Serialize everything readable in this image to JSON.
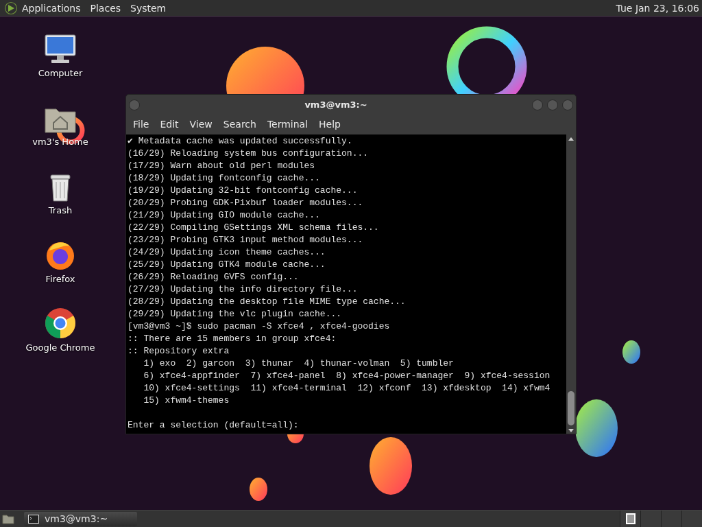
{
  "top_panel": {
    "menus": [
      "Applications",
      "Places",
      "System"
    ],
    "clock": "Tue Jan 23, 16:06"
  },
  "desktop_icons": [
    {
      "kind": "computer",
      "label": "Computer"
    },
    {
      "kind": "home",
      "label": "vm3's Home"
    },
    {
      "kind": "trash",
      "label": "Trash"
    },
    {
      "kind": "firefox",
      "label": "Firefox"
    },
    {
      "kind": "chrome",
      "label": "Google Chrome"
    }
  ],
  "terminal": {
    "title": "vm3@vm3:~",
    "menu": [
      "File",
      "Edit",
      "View",
      "Search",
      "Terminal",
      "Help"
    ],
    "lines": [
      "✔ Metadata cache was updated successfully.",
      "(16/29) Reloading system bus configuration...",
      "(17/29) Warn about old perl modules",
      "(18/29) Updating fontconfig cache...",
      "(19/29) Updating 32-bit fontconfig cache...",
      "(20/29) Probing GDK-Pixbuf loader modules...",
      "(21/29) Updating GIO module cache...",
      "(22/29) Compiling GSettings XML schema files...",
      "(23/29) Probing GTK3 input method modules...",
      "(24/29) Updating icon theme caches...",
      "(25/29) Updating GTK4 module cache...",
      "(26/29) Reloading GVFS config...",
      "(27/29) Updating the info directory file...",
      "(28/29) Updating the desktop file MIME type cache...",
      "(29/29) Updating the vlc plugin cache...",
      "[vm3@vm3 ~]$ sudo pacman -S xfce4 , xfce4-goodies",
      ":: There are 15 members in group xfce4:",
      ":: Repository extra",
      "   1) exo  2) garcon  3) thunar  4) thunar-volman  5) tumbler",
      "   6) xfce4-appfinder  7) xfce4-panel  8) xfce4-power-manager  9) xfce4-session",
      "   10) xfce4-settings  11) xfce4-terminal  12) xfconf  13) xfdesktop  14) xfwm4",
      "   15) xfwm4-themes"
    ],
    "prompt": "Enter a selection (default=all):"
  },
  "bottom_panel": {
    "tasks": [
      {
        "label": "vm3@vm3:~",
        "selected": false
      }
    ],
    "workspaces": [
      {
        "selected": true
      },
      {
        "selected": false
      },
      {
        "selected": false
      },
      {
        "selected": false
      }
    ]
  }
}
